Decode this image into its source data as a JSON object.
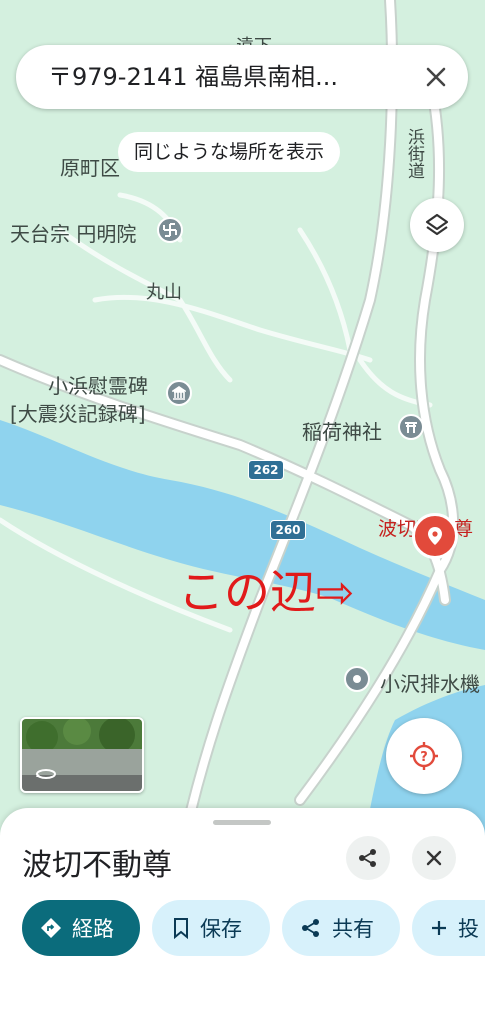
{
  "search": {
    "query": "〒979-2141 福島県南相...",
    "clear_icon": "close-icon"
  },
  "similar_places": {
    "label": "同じような場所を表示"
  },
  "map": {
    "labels": {
      "top_partial": "遠下",
      "haramachi": "原町区",
      "tendai": "天台宗 円明院",
      "maruyama": "丸山",
      "irei_line1": "小浜慰霊碑",
      "irei_line2": "[大震災記録碑]",
      "inari": "稲荷神社",
      "hamakaido": "浜街道",
      "hakiri_partial": "波切不動尊",
      "ozawa": "小沢排水機"
    },
    "route_shields": {
      "r262": "262",
      "r260": "260"
    },
    "annotation": "この辺⇨",
    "colors": {
      "land": "#d4f0df",
      "water": "#8fd3ee",
      "road": "#ffffff",
      "pin": "#e24a3b",
      "annotation": "#e11a1a"
    },
    "icons": [
      "manji-icon",
      "monument-icon",
      "shrine-icon",
      "location-pin-icon",
      "layers-icon",
      "locate-icon",
      "street-view-icon"
    ]
  },
  "sheet": {
    "title": "波切不動尊",
    "actions": [
      {
        "label": "経路",
        "icon": "directions-icon"
      },
      {
        "label": "保存",
        "icon": "bookmark-icon"
      },
      {
        "label": "共有",
        "icon": "share-icon"
      },
      {
        "label": "投",
        "icon": "plus-icon"
      }
    ]
  }
}
